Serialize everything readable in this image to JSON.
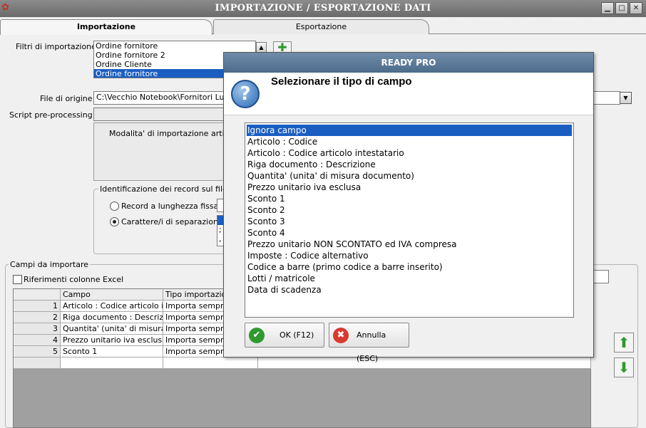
{
  "window": {
    "title": "IMPORTAZIONE / ESPORTAZIONE DATI",
    "icon": "app-icon",
    "controls": [
      "minimize",
      "maximize",
      "close"
    ]
  },
  "tabs": [
    {
      "label": "Importazione",
      "active": true
    },
    {
      "label": "Esportazione",
      "active": false
    }
  ],
  "filters": {
    "label": "Filtri di importazione :",
    "items": [
      "Ordine fornitore",
      "Ordine fornitore 2",
      "Ordine Cliente",
      "Ordine fornitore"
    ],
    "selected_index": 3
  },
  "source_file": {
    "label": "File di origine :",
    "value": "C:\\Vecchio Notebook\\Fornitori Lumi\\E"
  },
  "script": {
    "label": "Script pre-processing :"
  },
  "description": "Modalita' di importazione articoli d",
  "record_id": {
    "title": "Identificazione dei record sul file di o",
    "option_fixed": "Record a lunghezza fissa",
    "option_separator": "Carattere/i di separazione",
    "selected": "separator",
    "separator_values": [
      "",
      ";",
      ","
    ]
  },
  "fields": {
    "title": "Campi da importare",
    "excel_refs_label": "Riferimenti colonne Excel",
    "excel_refs_checked": false,
    "columns": [
      "Campo",
      "Tipo importazione"
    ],
    "rows": [
      {
        "n": "1",
        "campo": "Articolo : Codice articolo i...",
        "tipo": "Importa sempre"
      },
      {
        "n": "2",
        "campo": "Riga documento : Descrizi",
        "tipo": "Importa sempre"
      },
      {
        "n": "3",
        "campo": "Quantita' (unita' di misura ...",
        "tipo": "Importa sempre"
      },
      {
        "n": "4",
        "campo": "Prezzo unitario iva esclusa",
        "tipo": "Importa sempre"
      },
      {
        "n": "5",
        "campo": "Sconto 1",
        "tipo": "Importa sempre"
      }
    ]
  },
  "modal": {
    "title": "READY PRO",
    "heading": "Selezionare il tipo di campo",
    "options": [
      "Ignora campo",
      "Articolo : Codice",
      "Articolo : Codice articolo intestatario",
      "Riga documento : Descrizione",
      "Quantita' (unita' di misura documento)",
      "Prezzo unitario iva esclusa",
      "Sconto 1",
      "Sconto 2",
      "Sconto 3",
      "Sconto 4",
      "Prezzo unitario NON SCONTATO ed IVA compresa",
      "Imposte : Codice alternativo",
      "Codice a barre (primo codice a barre inserito)",
      "Lotti / matricole",
      "Data di scadenza"
    ],
    "selected_index": 0,
    "ok_label": "OK (F12)",
    "cancel_label": "Annulla (ESC)"
  },
  "colors": {
    "selection": "#1a5ec2",
    "accent_green": "#2f9a2f",
    "modal_title": "#5a7898"
  }
}
